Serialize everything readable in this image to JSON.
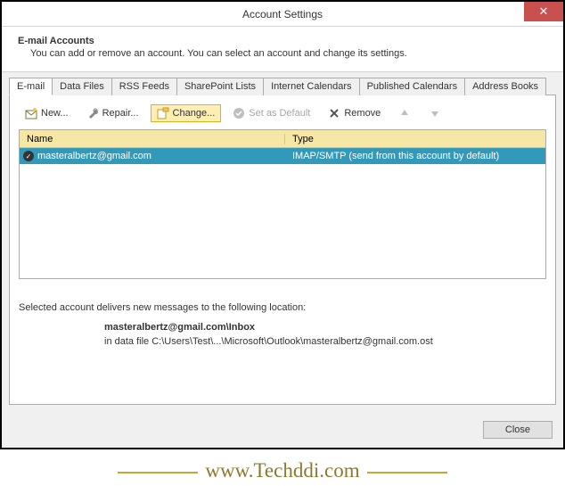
{
  "window": {
    "title": "Account Settings",
    "close_glyph": "✕"
  },
  "header": {
    "title": "E-mail Accounts",
    "description": "You can add or remove an account. You can select an account and change its settings."
  },
  "tabs": [
    {
      "label": "E-mail",
      "active": true
    },
    {
      "label": "Data Files",
      "active": false
    },
    {
      "label": "RSS Feeds",
      "active": false
    },
    {
      "label": "SharePoint Lists",
      "active": false
    },
    {
      "label": "Internet Calendars",
      "active": false
    },
    {
      "label": "Published Calendars",
      "active": false
    },
    {
      "label": "Address Books",
      "active": false
    }
  ],
  "toolbar": {
    "new_label": "New...",
    "repair_label": "Repair...",
    "change_label": "Change...",
    "set_default_label": "Set as Default",
    "remove_label": "Remove"
  },
  "table": {
    "headers": {
      "name": "Name",
      "type": "Type"
    },
    "rows": [
      {
        "name": "masteralbertz@gmail.com",
        "type": "IMAP/SMTP (send from this account by default)",
        "selected": true
      }
    ]
  },
  "delivery": {
    "intro": "Selected account delivers new messages to the following location:",
    "location": "masteralbertz@gmail.com\\Inbox",
    "datafile": "in data file C:\\Users\\Test\\...\\Microsoft\\Outlook\\masteralbertz@gmail.com.ost"
  },
  "footer": {
    "close_label": "Close"
  },
  "watermark": "www.Techddi.com"
}
